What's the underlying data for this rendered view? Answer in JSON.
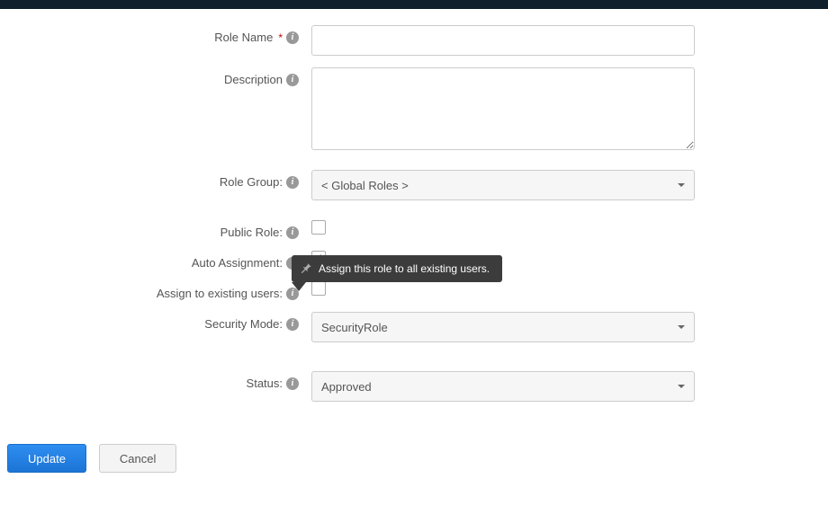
{
  "tooltip": {
    "text": "Assign this role to all existing users."
  },
  "form": {
    "roleName": {
      "label": "Role Name",
      "value": "",
      "placeholder": ""
    },
    "description": {
      "label": "Description",
      "value": ""
    },
    "roleGroup": {
      "label": "Role Group:",
      "value": "< Global Roles >"
    },
    "publicRole": {
      "label": "Public Role:",
      "checked": false
    },
    "autoAssignment": {
      "label": "Auto Assignment:",
      "checked": true
    },
    "assignExisting": {
      "label": "Assign to existing users:",
      "checked": false
    },
    "securityMode": {
      "label": "Security Mode:",
      "value": "SecurityRole"
    },
    "status": {
      "label": "Status:",
      "value": "Approved"
    }
  },
  "buttons": {
    "update": "Update",
    "cancel": "Cancel"
  }
}
